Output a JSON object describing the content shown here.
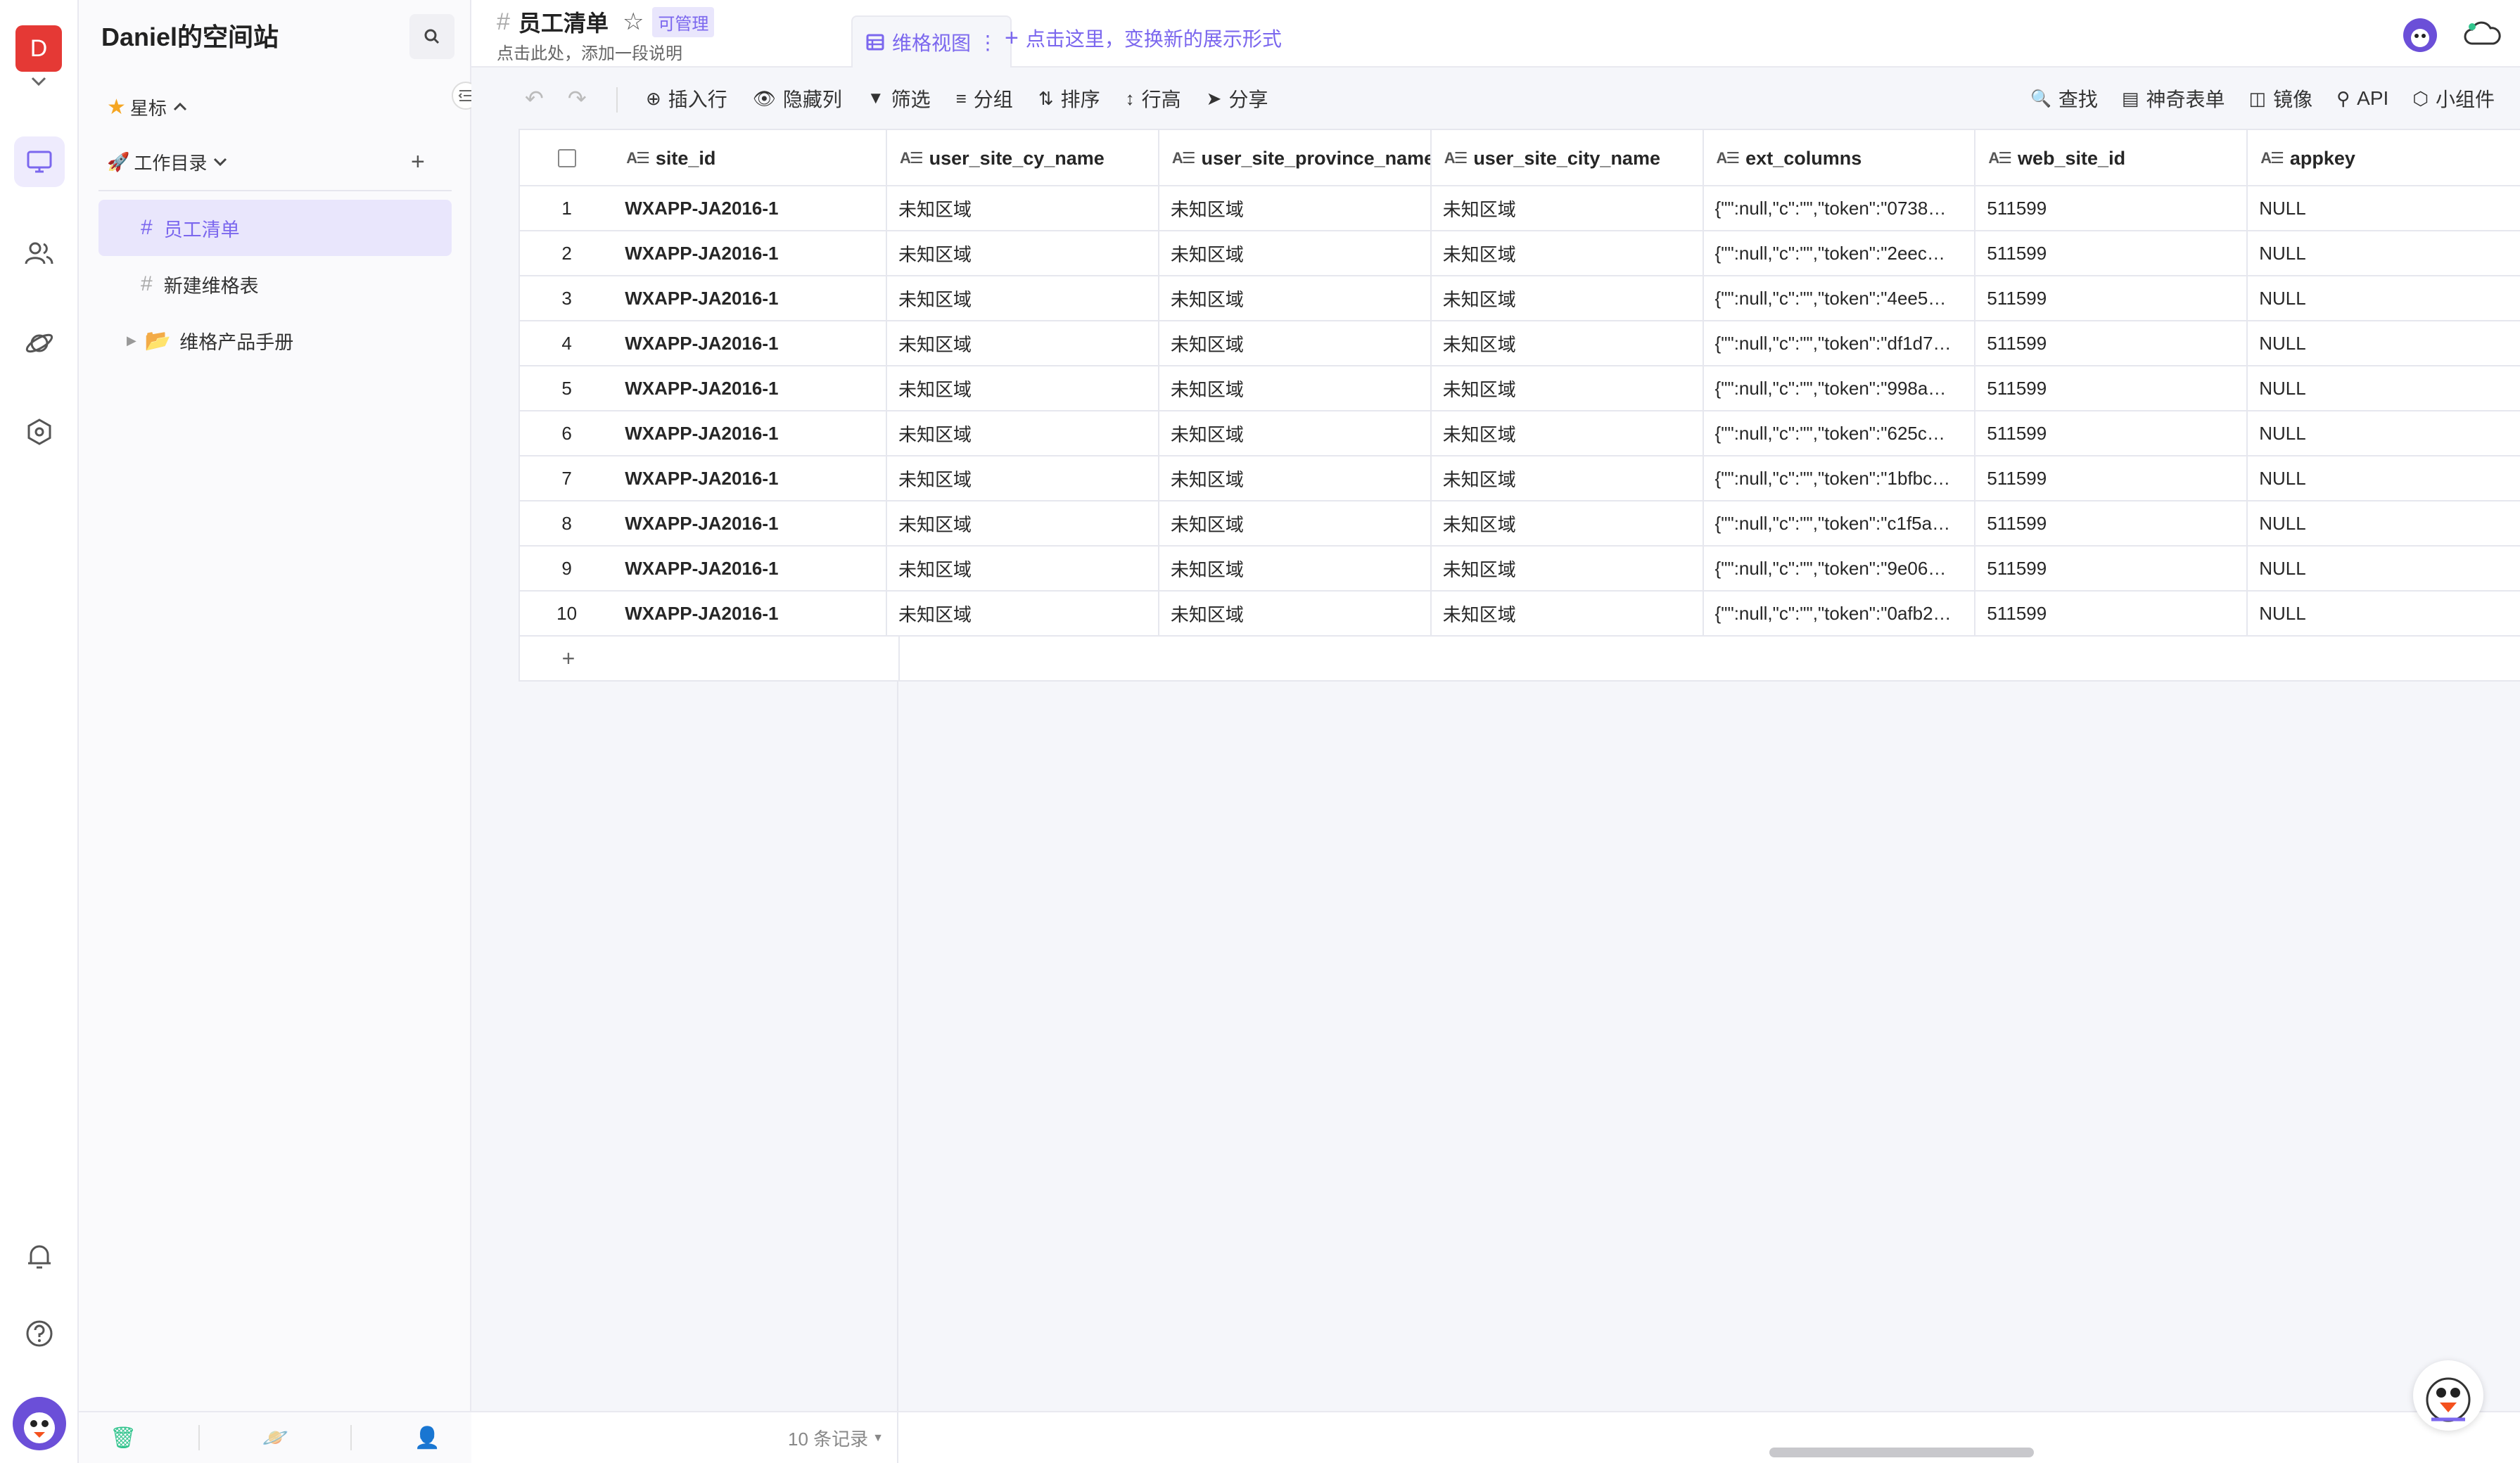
{
  "workspace": {
    "initial": "D",
    "name": "Daniel的空间站"
  },
  "sidebar": {
    "starred_label": "星标",
    "catalog_label": "工作目录",
    "items": [
      {
        "label": "员工清单",
        "active": true
      },
      {
        "label": "新建维格表",
        "active": false
      },
      {
        "label": "维格产品手册",
        "active": false
      }
    ]
  },
  "header": {
    "title": "员工清单",
    "badge": "可管理",
    "description": "点击此处，添加一段说明",
    "view_tab": "维格视图",
    "add_view": "点击这里，变换新的展示形式"
  },
  "toolbar": {
    "insert_row": "插入行",
    "hide_cols": "隐藏列",
    "filter": "筛选",
    "group": "分组",
    "sort": "排序",
    "row_height": "行高",
    "share": "分享",
    "find": "查找",
    "magic_form": "神奇表单",
    "mirror": "镜像",
    "api": "API",
    "widgets": "小组件"
  },
  "table": {
    "columns": [
      "site_id",
      "user_site_cy_name",
      "user_site_province_name",
      "user_site_city_name",
      "ext_columns",
      "web_site_id",
      "appkey"
    ],
    "rows": [
      [
        "1",
        "WXAPP-JA2016-1",
        "未知区域",
        "未知区域",
        "未知区域",
        "{\"\":null,\"c\":\"\",\"token\":\"0738…",
        "511599",
        "NULL"
      ],
      [
        "2",
        "WXAPP-JA2016-1",
        "未知区域",
        "未知区域",
        "未知区域",
        "{\"\":null,\"c\":\"\",\"token\":\"2eec…",
        "511599",
        "NULL"
      ],
      [
        "3",
        "WXAPP-JA2016-1",
        "未知区域",
        "未知区域",
        "未知区域",
        "{\"\":null,\"c\":\"\",\"token\":\"4ee5…",
        "511599",
        "NULL"
      ],
      [
        "4",
        "WXAPP-JA2016-1",
        "未知区域",
        "未知区域",
        "未知区域",
        "{\"\":null,\"c\":\"\",\"token\":\"df1d7…",
        "511599",
        "NULL"
      ],
      [
        "5",
        "WXAPP-JA2016-1",
        "未知区域",
        "未知区域",
        "未知区域",
        "{\"\":null,\"c\":\"\",\"token\":\"998a…",
        "511599",
        "NULL"
      ],
      [
        "6",
        "WXAPP-JA2016-1",
        "未知区域",
        "未知区域",
        "未知区域",
        "{\"\":null,\"c\":\"\",\"token\":\"625c…",
        "511599",
        "NULL"
      ],
      [
        "7",
        "WXAPP-JA2016-1",
        "未知区域",
        "未知区域",
        "未知区域",
        "{\"\":null,\"c\":\"\",\"token\":\"1bfbc…",
        "511599",
        "NULL"
      ],
      [
        "8",
        "WXAPP-JA2016-1",
        "未知区域",
        "未知区域",
        "未知区域",
        "{\"\":null,\"c\":\"\",\"token\":\"c1f5a…",
        "511599",
        "NULL"
      ],
      [
        "9",
        "WXAPP-JA2016-1",
        "未知区域",
        "未知区域",
        "未知区域",
        "{\"\":null,\"c\":\"\",\"token\":\"9e06…",
        "511599",
        "NULL"
      ],
      [
        "10",
        "WXAPP-JA2016-1",
        "未知区域",
        "未知区域",
        "未知区域",
        "{\"\":null,\"c\":\"\",\"token\":\"0afb2…",
        "511599",
        "NULL"
      ]
    ],
    "add_row_symbol": "+"
  },
  "footer": {
    "record_count": "10 条记录"
  },
  "colors": {
    "accent": "#7b67ee",
    "avatar_red": "#e53935",
    "active_bg": "#e9e6fc"
  }
}
